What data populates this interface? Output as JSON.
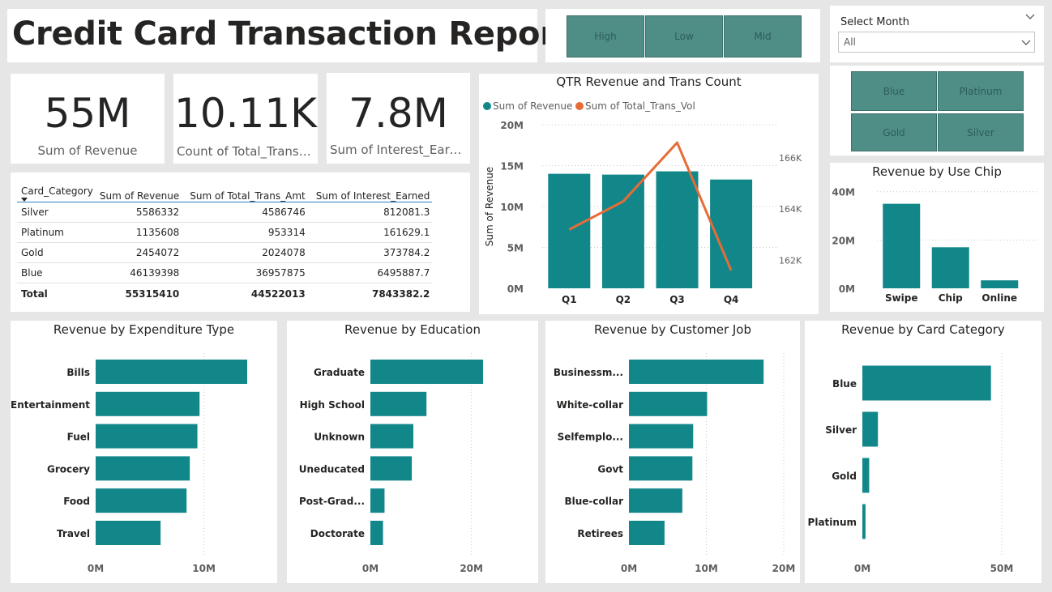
{
  "report": {
    "title": "Credit Card Transaction Report"
  },
  "income_slicer": {
    "buttons": [
      "High",
      "Low",
      "Mid"
    ]
  },
  "month_slicer": {
    "label": "Select Month",
    "value": "All"
  },
  "category_slicer": {
    "buttons": [
      "Blue",
      "Platinum",
      "Gold",
      "Silver"
    ]
  },
  "kpis": {
    "revenue": {
      "value": "55M",
      "label": "Sum of Revenue"
    },
    "trans_count": {
      "value": "10.11K",
      "label": "Count of Total_Trans_..."
    },
    "interest": {
      "value": "7.8M",
      "label": "Sum of Interest_Earned"
    }
  },
  "table": {
    "headers": [
      "Card_Category",
      "Sum of Revenue",
      "Sum of Total_Trans_Amt",
      "Sum of Interest_Earned"
    ],
    "rows": [
      [
        "Silver",
        "5586332",
        "4586746",
        "812081.3"
      ],
      [
        "Platinum",
        "1135608",
        "953314",
        "161629.1"
      ],
      [
        "Gold",
        "2454072",
        "2024078",
        "373784.2"
      ],
      [
        "Blue",
        "46139398",
        "36957875",
        "6495887.7"
      ]
    ],
    "total": [
      "Total",
      "55315410",
      "44522013",
      "7843382.2"
    ]
  },
  "colors": {
    "bar": "#12878a",
    "line": "#e66c37",
    "slicer": "#4e8e86"
  },
  "chart_data": [
    {
      "id": "qtr",
      "type": "bar+line",
      "title": "QTR Revenue and Trans Count",
      "legend": [
        "Sum of Revenue",
        "Sum of Total_Trans_Vol"
      ],
      "legend_position": "top-left",
      "categories": [
        "Q1",
        "Q2",
        "Q3",
        "Q4"
      ],
      "ylabel": "Sum of Revenue",
      "ylim": [
        0,
        20000000
      ],
      "yticks": [
        "0M",
        "5M",
        "10M",
        "15M",
        "20M"
      ],
      "y2ticks": [
        "162K",
        "164K",
        "166K"
      ],
      "y2lim": [
        160900,
        167300
      ],
      "series": [
        {
          "name": "Sum of Revenue",
          "type": "bar",
          "values": [
            14000000,
            13900000,
            14300000,
            13300000
          ]
        },
        {
          "name": "Sum of Total_Trans_Vol",
          "type": "line",
          "values": [
            163200,
            164300,
            166600,
            161600
          ]
        }
      ]
    },
    {
      "id": "chip",
      "type": "bar",
      "title": "Revenue by Use Chip",
      "categories": [
        "Swipe",
        "Chip",
        "Online"
      ],
      "values": [
        35000000,
        17000000,
        3300000
      ],
      "ylim": [
        0,
        45000000
      ],
      "yticks": [
        "0M",
        "20M",
        "40M"
      ]
    },
    {
      "id": "exp",
      "type": "horizontal-bar",
      "title": "Revenue by Expenditure Type",
      "categories": [
        "Bills",
        "Entertainment",
        "Fuel",
        "Grocery",
        "Food",
        "Travel"
      ],
      "values": [
        14000000,
        9600000,
        9400000,
        8700000,
        8400000,
        6000000
      ],
      "xlim": [
        0,
        15000000
      ],
      "xticks": [
        "0M",
        "10M"
      ]
    },
    {
      "id": "edu",
      "type": "horizontal-bar",
      "title": "Revenue by Education",
      "categories": [
        "Graduate",
        "High School",
        "Unknown",
        "Uneducated",
        "Post-Grad...",
        "Doctorate"
      ],
      "values": [
        22300000,
        11100000,
        8500000,
        8200000,
        2800000,
        2500000
      ],
      "xlim": [
        0,
        25000000
      ],
      "xticks": [
        "0M",
        "20M"
      ]
    },
    {
      "id": "job",
      "type": "horizontal-bar",
      "title": "Revenue by Customer Job",
      "categories": [
        "Businessm...",
        "White-collar",
        "Selfemplo...",
        "Govt",
        "Blue-collar",
        "Retirees"
      ],
      "values": [
        17400000,
        10100000,
        8300000,
        8200000,
        6900000,
        4600000
      ],
      "xlim": [
        0,
        20000000
      ],
      "xticks": [
        "0M",
        "10M",
        "20M"
      ]
    },
    {
      "id": "cat",
      "type": "horizontal-bar",
      "title": "Revenue by Card Category",
      "categories": [
        "Blue",
        "Silver",
        "Gold",
        "Platinum"
      ],
      "values": [
        46139398,
        5586332,
        2454072,
        1135608
      ],
      "xlim": [
        0,
        55000000
      ],
      "xticks": [
        "0M",
        "50M"
      ]
    }
  ]
}
